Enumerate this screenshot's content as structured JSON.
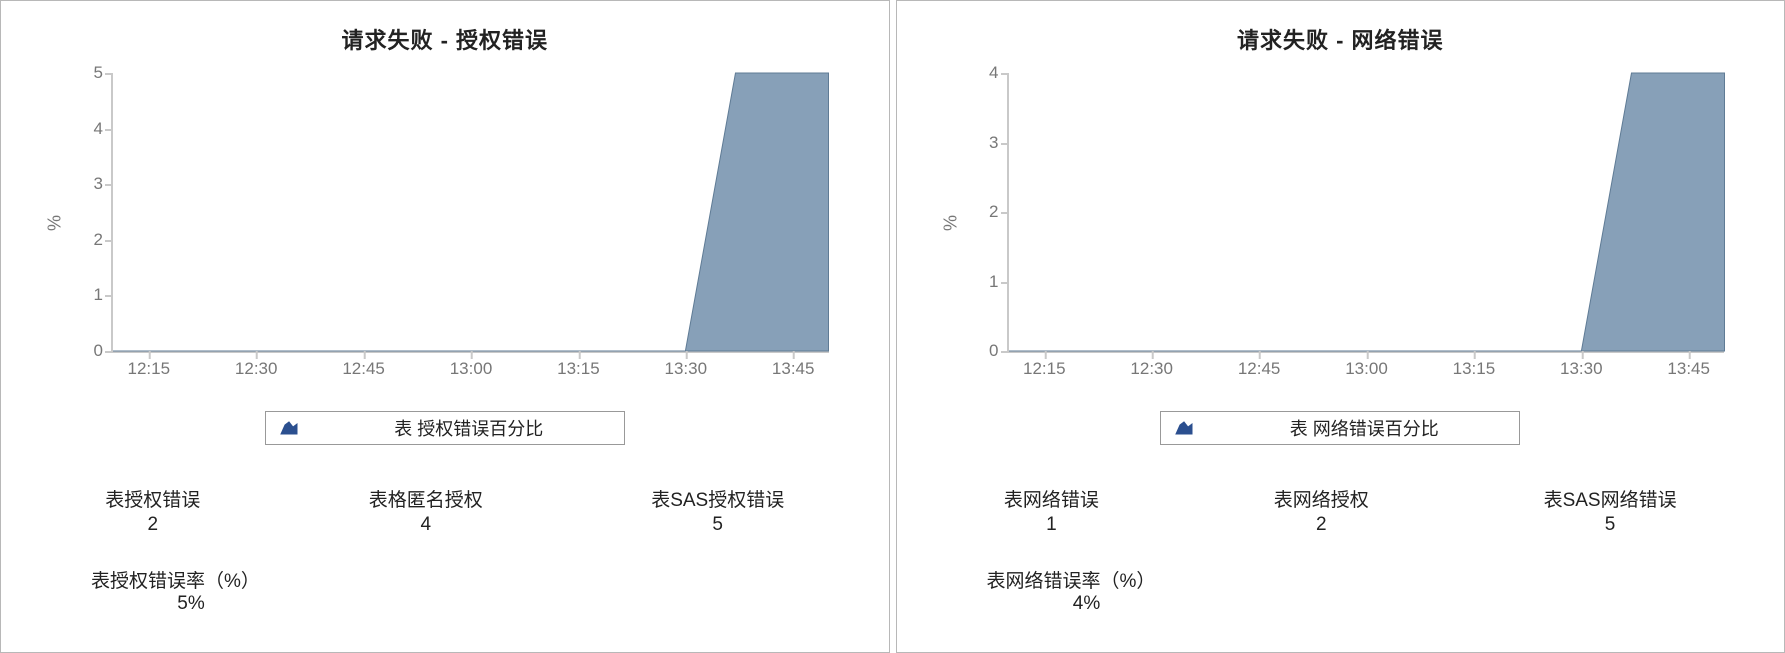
{
  "panels": [
    {
      "title": "请求失败 - 授权错误",
      "ylabel": "%",
      "legend": "表 授权错误百分比",
      "stats": [
        {
          "label": "表授权错误",
          "value": "2"
        },
        {
          "label": "表格匿名授权",
          "value": "4"
        },
        {
          "label": "表SAS授权错误",
          "value": "5"
        }
      ],
      "footer": {
        "label": "表授权错误率（%）",
        "value": "5%"
      }
    },
    {
      "title": "请求失败 - 网络错误",
      "ylabel": "%",
      "legend": "表 网络错误百分比",
      "stats": [
        {
          "label": "表网络错误",
          "value": "1"
        },
        {
          "label": "表网络授权",
          "value": "2"
        },
        {
          "label": "表SAS网络错误",
          "value": "5"
        }
      ],
      "footer": {
        "label": "表网络错误率（%）",
        "value": "4%"
      }
    }
  ],
  "chart_data": [
    {
      "type": "area",
      "title": "请求失败 - 授权错误",
      "xlabel": "",
      "ylabel": "%",
      "ylim": [
        0,
        5
      ],
      "xlim": [
        "12:10",
        "13:50"
      ],
      "xticks": [
        "12:15",
        "12:30",
        "12:45",
        "13:00",
        "13:15",
        "13:30",
        "13:45"
      ],
      "yticks": [
        0,
        1,
        2,
        3,
        4,
        5
      ],
      "series": [
        {
          "name": "表 授权错误百分比",
          "x": [
            "12:10",
            "12:15",
            "12:30",
            "12:45",
            "13:00",
            "13:15",
            "13:30",
            "13:37",
            "13:50"
          ],
          "y": [
            0,
            0,
            0,
            0,
            0,
            0,
            0,
            5,
            5
          ]
        }
      ]
    },
    {
      "type": "area",
      "title": "请求失败 - 网络错误",
      "xlabel": "",
      "ylabel": "%",
      "ylim": [
        0,
        4
      ],
      "xlim": [
        "12:10",
        "13:50"
      ],
      "xticks": [
        "12:15",
        "12:30",
        "12:45",
        "13:00",
        "13:15",
        "13:30",
        "13:45"
      ],
      "yticks": [
        0,
        1,
        2,
        3,
        4
      ],
      "series": [
        {
          "name": "表 网络错误百分比",
          "x": [
            "12:10",
            "12:15",
            "12:30",
            "12:45",
            "13:00",
            "13:15",
            "13:30",
            "13:37",
            "13:50"
          ],
          "y": [
            0,
            0,
            0,
            0,
            0,
            0,
            0,
            4,
            4
          ]
        }
      ]
    }
  ]
}
